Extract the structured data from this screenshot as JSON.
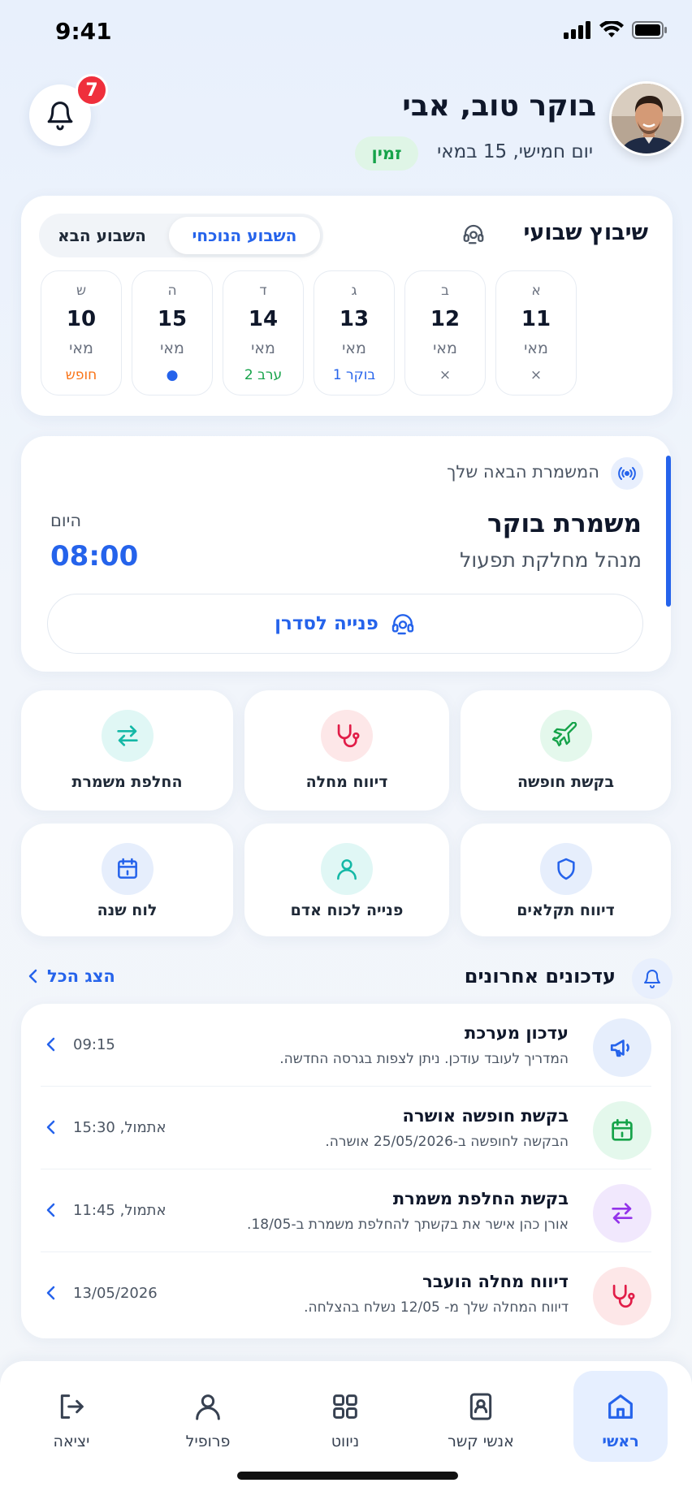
{
  "status_bar": {
    "time": "9:41"
  },
  "header": {
    "notification_count": "7",
    "greeting": "בוקר טוב, אבי",
    "date": "יום חמישי, 15 במאי",
    "availability_status": "זמין"
  },
  "weekly_schedule": {
    "title": "שיבוץ שבועי",
    "toggle_current": "השבוע הנוכחי",
    "toggle_next": "השבוע הבא",
    "days": [
      {
        "letter": "א",
        "num": "11",
        "month": "מאי",
        "status": "×",
        "status_color": "#6b7280"
      },
      {
        "letter": "ב",
        "num": "12",
        "month": "מאי",
        "status": "×",
        "status_color": "#6b7280"
      },
      {
        "letter": "ג",
        "num": "13",
        "month": "מאי",
        "status": "בוקר 1",
        "status_color": "#2563eb"
      },
      {
        "letter": "ד",
        "num": "14",
        "month": "מאי",
        "status": "ערב 2",
        "status_color": "#16a34a"
      },
      {
        "letter": "ה",
        "num": "15",
        "month": "מאי",
        "status": "●",
        "status_color": "#2563eb"
      },
      {
        "letter": "ש",
        "num": "10",
        "month": "מאי",
        "status": "חופש",
        "status_color": "#f97316"
      }
    ]
  },
  "next_shift": {
    "label": "המשמרת הבאה שלך",
    "name": "משמרת בוקר",
    "role": "מנהל מחלקת תפעול",
    "day": "היום",
    "time": "08:00",
    "contact_button": "פנייה לסדרן"
  },
  "actions": [
    {
      "label": "בקשת חופשה",
      "icon": "plane-icon",
      "bg": "#e4f8ec",
      "color": "#16a34a"
    },
    {
      "label": "דיווח מחלה",
      "icon": "stethoscope-icon",
      "bg": "#fde7e8",
      "color": "#e11d48"
    },
    {
      "label": "החלפת משמרת",
      "icon": "swap-icon",
      "bg": "#e0f7f5",
      "color": "#14b8a6"
    },
    {
      "label": "דיווח תקלאים",
      "icon": "shield-icon",
      "bg": "#e6eefc",
      "color": "#2563eb"
    },
    {
      "label": "פנייה לכוח אדם",
      "icon": "person-icon",
      "bg": "#e0f7f5",
      "color": "#14b8a6"
    },
    {
      "label": "לוח שנה",
      "icon": "calendar-icon",
      "bg": "#e6eefc",
      "color": "#2563eb"
    }
  ],
  "updates": {
    "title": "עדכונים אחרונים",
    "show_all": "הצג הכל",
    "items": [
      {
        "title": "עדכון מערכת",
        "desc": "המדריך לעובד עודכן. ניתן לצפות בגרסה החדשה.",
        "time": "09:15",
        "icon": "megaphone-icon",
        "bg": "#e6eefc",
        "color": "#2563eb"
      },
      {
        "title": "בקשת חופשה אושרה",
        "desc": "הבקשה לחופשה ב-25/05/2026 אושרה.",
        "time": "אתמול, 15:30",
        "icon": "calendar-icon",
        "bg": "#e4f8ec",
        "color": "#16a34a"
      },
      {
        "title": "בקשת החלפת משמרת",
        "desc": "אורן כהן אישר את בקשתך להחלפת משמרת ב-18/05.",
        "time": "אתמול, 11:45",
        "icon": "swap-icon",
        "bg": "#f1e8fd",
        "color": "#9333ea"
      },
      {
        "title": "דיווח מחלה הועבר",
        "desc": "דיווח המחלה שלך מ- 12/05 נשלח בהצלחה.",
        "time": "13/05/2026",
        "icon": "stethoscope-icon",
        "bg": "#fde7e8",
        "color": "#e11d48"
      }
    ]
  },
  "bottom_nav": {
    "items": [
      {
        "label": "ראשי",
        "icon": "home-icon",
        "active": true
      },
      {
        "label": "אנשי קשר",
        "icon": "contacts-icon",
        "active": false
      },
      {
        "label": "ניווט",
        "icon": "grid-icon",
        "active": false
      },
      {
        "label": "פרופיל",
        "icon": "profile-icon",
        "active": false
      },
      {
        "label": "יציאה",
        "icon": "logout-icon",
        "active": false
      }
    ]
  },
  "colors": {
    "accent": "#2563eb",
    "badge": "#ef2f3c",
    "available": "#16a34a"
  }
}
